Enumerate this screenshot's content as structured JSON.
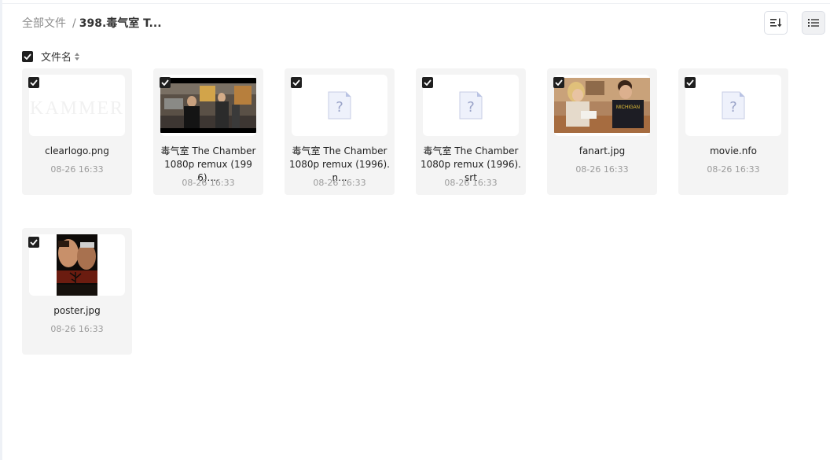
{
  "breadcrumb": {
    "root": "全部文件",
    "separator": "/",
    "current": "398.毒气室 T..."
  },
  "header": {
    "name_label": "文件名"
  },
  "toolbar": {
    "sort_icon": "sort-icon",
    "list_icon": "list-view-icon"
  },
  "files": [
    {
      "name": "clearlogo.png",
      "date": "08-26 16:33",
      "thumb": "logo-image"
    },
    {
      "name": "毒气室 The Chamber 1080p remux (1996)....",
      "date": "08-26 16:33",
      "thumb": "video-frame"
    },
    {
      "name": "毒气室 The Chamber 1080p remux (1996).n...",
      "date": "08-26 16:33",
      "thumb": "unknown-file-icon"
    },
    {
      "name": "毒气室 The Chamber 1080p remux (1996).srt",
      "date": "08-26 16:33",
      "thumb": "unknown-file-icon"
    },
    {
      "name": "fanart.jpg",
      "date": "08-26 16:33",
      "thumb": "fanart-image"
    },
    {
      "name": "movie.nfo",
      "date": "08-26 16:33",
      "thumb": "unknown-file-icon"
    },
    {
      "name": "poster.jpg",
      "date": "08-26 16:33",
      "thumb": "poster-image"
    }
  ],
  "colors": {
    "accent": "#1f1f1f",
    "card_bg": "#f4f4f4",
    "muted": "#9a9a9a"
  }
}
